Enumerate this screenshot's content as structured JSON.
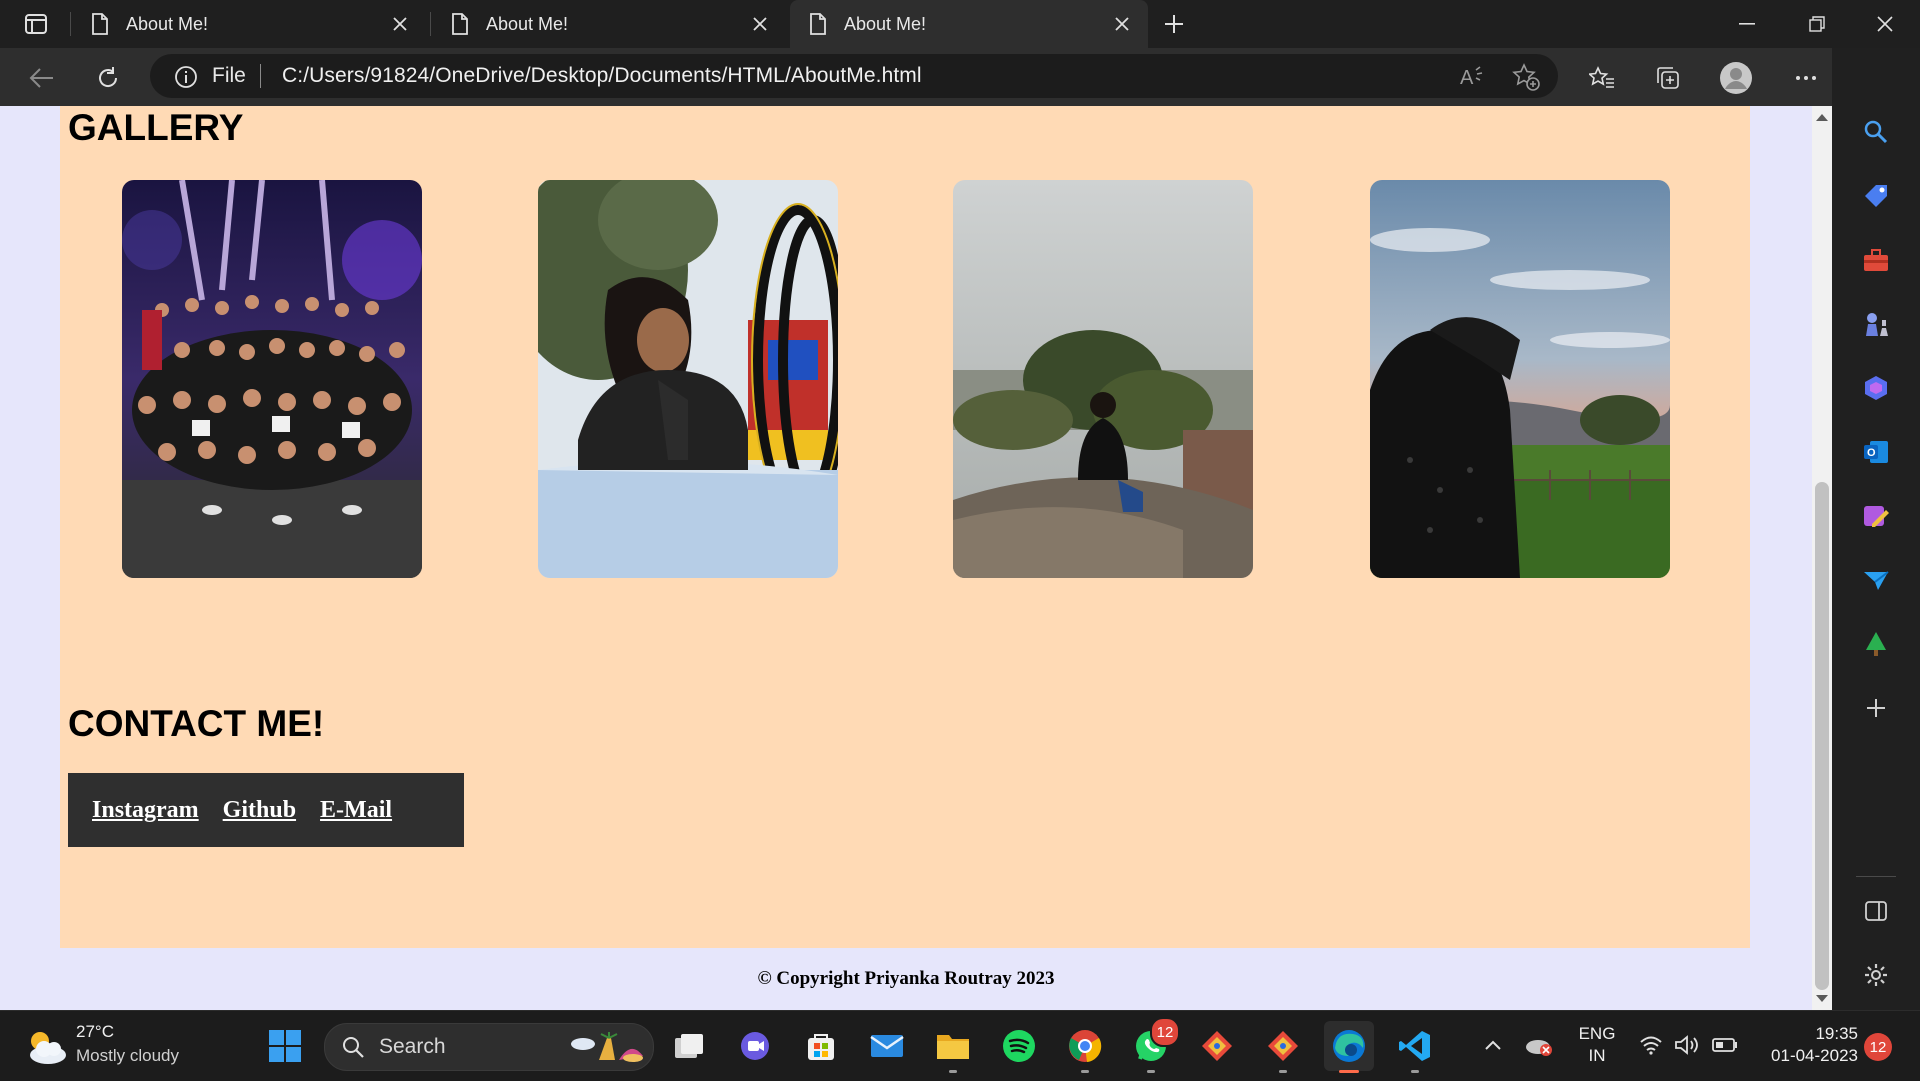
{
  "browser": {
    "tabs": [
      {
        "title": "About Me!",
        "active": false
      },
      {
        "title": "About Me!",
        "active": false
      },
      {
        "title": "About Me!",
        "active": true
      }
    ],
    "address": {
      "scheme_label": "File",
      "url": "C:/Users/91824/OneDrive/Desktop/Documents/HTML/AboutMe.html"
    }
  },
  "page": {
    "gallery_title": "GALLERY",
    "gallery_photos": [
      {
        "subject": "group photo at night event"
      },
      {
        "subject": "girl resting chin on hand near sculpture"
      },
      {
        "subject": "person sitting on rock overlooking hazy valley"
      },
      {
        "subject": "person facing sunset over green field"
      }
    ],
    "contact_title": "CONTACT ME!",
    "contact_links": [
      "Instagram",
      "Github",
      "E-Mail"
    ],
    "copyright": "© Copyright Priyanka Routray 2023",
    "panel_color": "#ffdab5",
    "background_color": "#e6e6fb"
  },
  "sidebar": {
    "icons": [
      "search-icon",
      "tag-icon",
      "toolbox-icon",
      "chess-icon",
      "copilot-icon",
      "outlook-icon",
      "designer-icon",
      "send-icon",
      "tree-icon",
      "add-icon",
      "split-screen-icon",
      "settings-icon"
    ]
  },
  "taskbar": {
    "weather": {
      "temp": "27°C",
      "desc": "Mostly cloudy"
    },
    "search_placeholder": "Search",
    "whatsapp_badge": "12",
    "language": {
      "line1": "ENG",
      "line2": "IN"
    },
    "time": "19:35",
    "date": "01-04-2023",
    "notifications": "12"
  }
}
